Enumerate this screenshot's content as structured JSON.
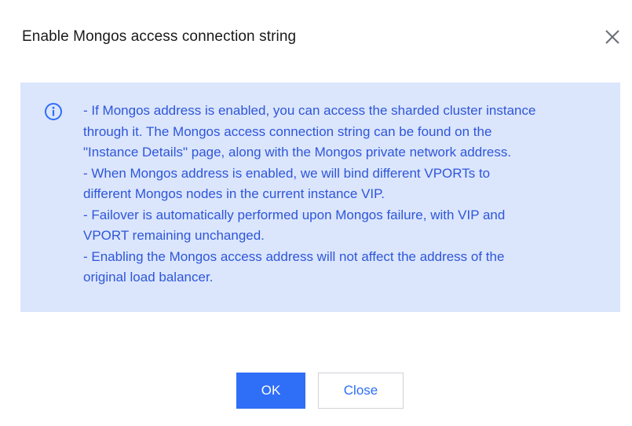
{
  "dialog": {
    "title": "Enable Mongos access connection string",
    "close_icon": "close-icon"
  },
  "notice": {
    "icon": "info-icon",
    "lines": [
      "- If Mongos address is enabled, you can access the sharded cluster instance",
      "through it. The Mongos access connection string can be found on the",
      "\"Instance Details\" page, along with the Mongos private network address.",
      "- When Mongos address is enabled, we will bind different VPORTs to",
      "different Mongos nodes in the current instance VIP.",
      "- Failover is automatically performed upon Mongos failure, with VIP and",
      "VPORT remaining unchanged.",
      "- Enabling the Mongos access address will not affect the address of the",
      "original load balancer."
    ]
  },
  "buttons": {
    "ok_label": "OK",
    "close_label": "Close"
  },
  "colors": {
    "primary": "#2f6ef7",
    "notice_bg": "#dbe6fd",
    "notice_text": "#2f56d8"
  }
}
